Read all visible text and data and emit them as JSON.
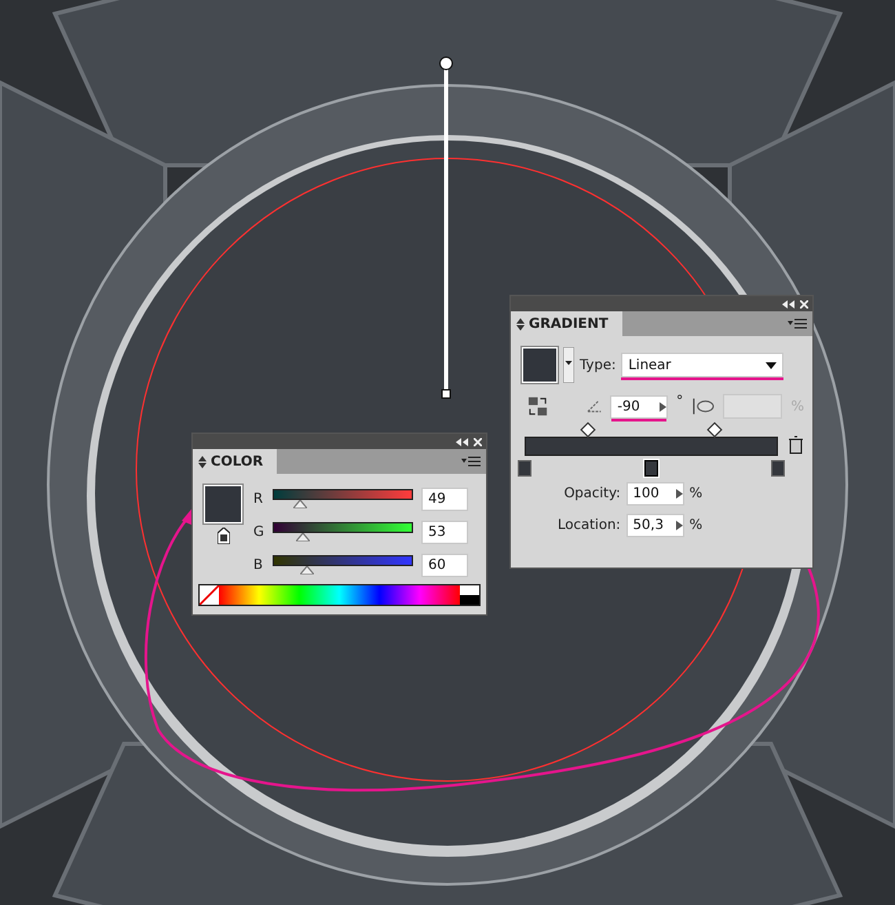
{
  "color_panel": {
    "title": "COLOR",
    "channels": [
      {
        "label": "R",
        "value": "49",
        "level": 0.19
      },
      {
        "label": "G",
        "value": "53",
        "level": 0.21
      },
      {
        "label": "B",
        "value": "60",
        "level": 0.24
      }
    ]
  },
  "gradient_panel": {
    "title": "GRADIENT",
    "type_label": "Type:",
    "type_value": "Linear",
    "angle": "-90",
    "degree_sign": "°",
    "aspect_unit": "%",
    "midpoints": [
      {
        "level": 0.25
      },
      {
        "level": 0.75
      }
    ],
    "stops": [
      {
        "level": 0,
        "selected": false
      },
      {
        "level": 0.5,
        "selected": true
      },
      {
        "level": 1,
        "selected": false
      }
    ],
    "opacity_label": "Opacity:",
    "opacity": "100",
    "opacity_unit": "%",
    "location_label": "Location:",
    "location": "50,3",
    "location_unit": "%"
  }
}
